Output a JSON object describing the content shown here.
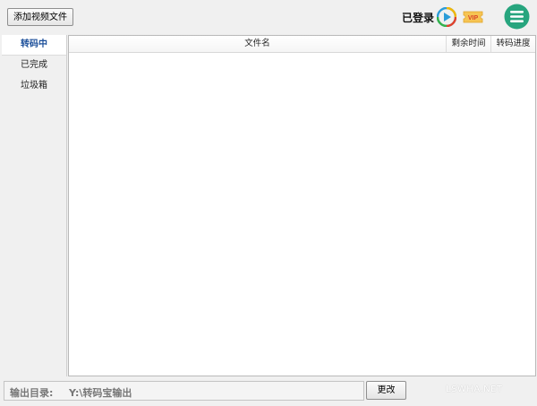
{
  "toolbar": {
    "add_video_label": "添加视频文件",
    "login_status": "已登录",
    "vip_icon": "vip-ticket-icon",
    "play_icon": "play-circle-icon",
    "menu_icon": "hamburger-menu-icon",
    "menu_color": "#27a57e"
  },
  "sidebar": {
    "items": [
      {
        "label": "转码中",
        "active": true
      },
      {
        "label": "已完成"
      },
      {
        "label": "垃圾箱"
      }
    ]
  },
  "file_list": {
    "columns": {
      "name": "文件名",
      "remaining_time": "剩余时间",
      "progress": "转码进度"
    },
    "rows": []
  },
  "output": {
    "label": "输出目录:",
    "path": "Y:\\转码宝输出",
    "change_label": "更改"
  },
  "watermark": "LSWHA.NET"
}
